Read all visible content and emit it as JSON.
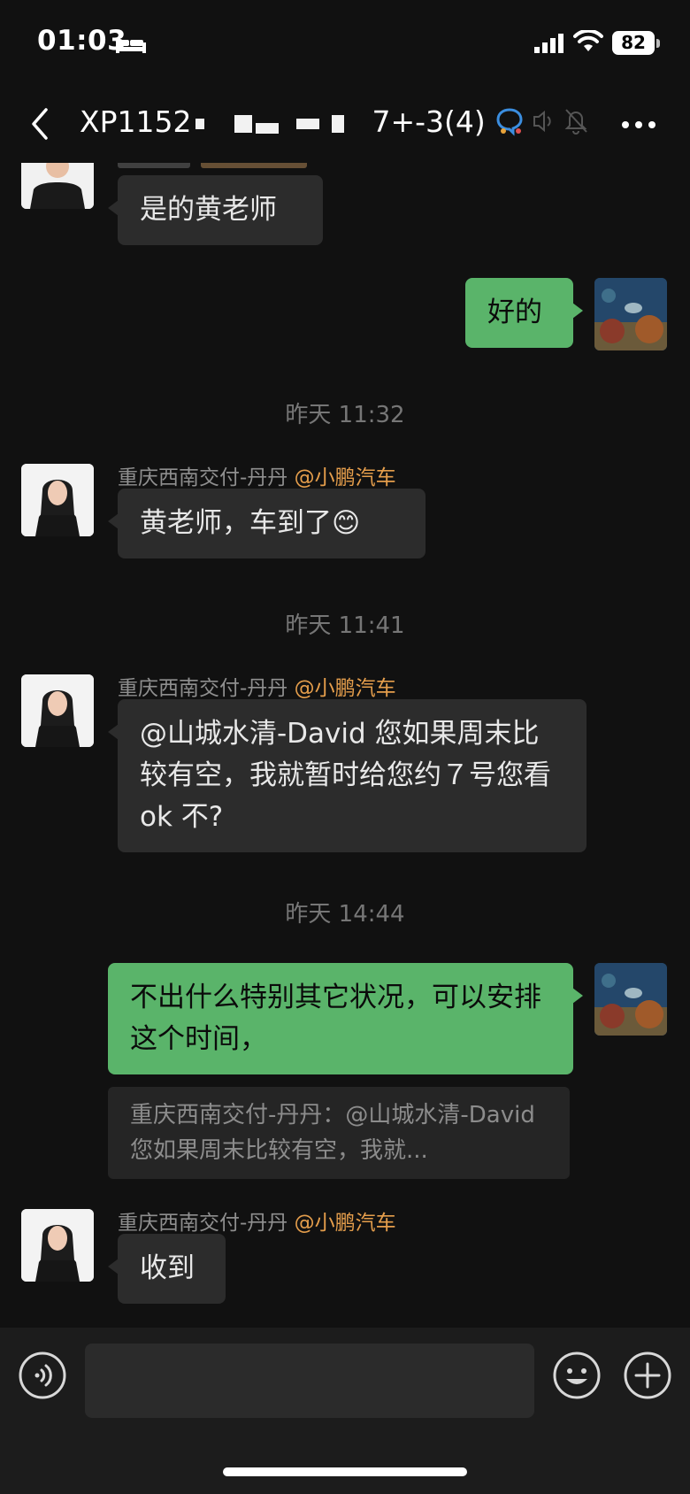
{
  "status_bar": {
    "time": "01:03",
    "battery": "82"
  },
  "header": {
    "title_prefix": "XP1152",
    "title_suffix": "7+-3(4)"
  },
  "messages": [
    {
      "type": "in",
      "avatar": "avatar-man",
      "text": "是的黄老师"
    },
    {
      "type": "out",
      "text": "好的"
    },
    {
      "type": "time",
      "text": "昨天 11:32"
    },
    {
      "type": "in",
      "sender": "重庆西南交付-丹丹",
      "tag": "@小鹏汽车",
      "text": "黄老师，车到了😊"
    },
    {
      "type": "time",
      "text": "昨天 11:41"
    },
    {
      "type": "in",
      "sender": "重庆西南交付-丹丹",
      "tag": "@小鹏汽车",
      "text": "@山城水清-David 您如果周末比较有空，我就暂时给您约７号您看 ok 不?"
    },
    {
      "type": "time",
      "text": "昨天 14:44"
    },
    {
      "type": "out",
      "text": "不出什么特别其它状况，可以安排这个时间，",
      "quote": "重庆西南交付-丹丹：@山城水清-David 您如果周末比较有空，我就..."
    },
    {
      "type": "in",
      "sender": "重庆西南交付-丹丹",
      "tag": "@小鹏汽车",
      "text": "收到"
    }
  ],
  "input": {
    "placeholder": ""
  },
  "colors": {
    "background": "#111111",
    "incoming_bubble": "#2c2c2c",
    "outgoing_bubble": "#5ab46a",
    "sender_tag": "#e59e4c",
    "input_bar": "#1c1c1c"
  },
  "icons": [
    "bed-icon",
    "signal-icon",
    "wifi-icon",
    "back-icon",
    "group-badge-icon",
    "speaker-icon",
    "mute-icon",
    "more-icon",
    "voice-icon",
    "emoji-icon",
    "plus-icon"
  ]
}
